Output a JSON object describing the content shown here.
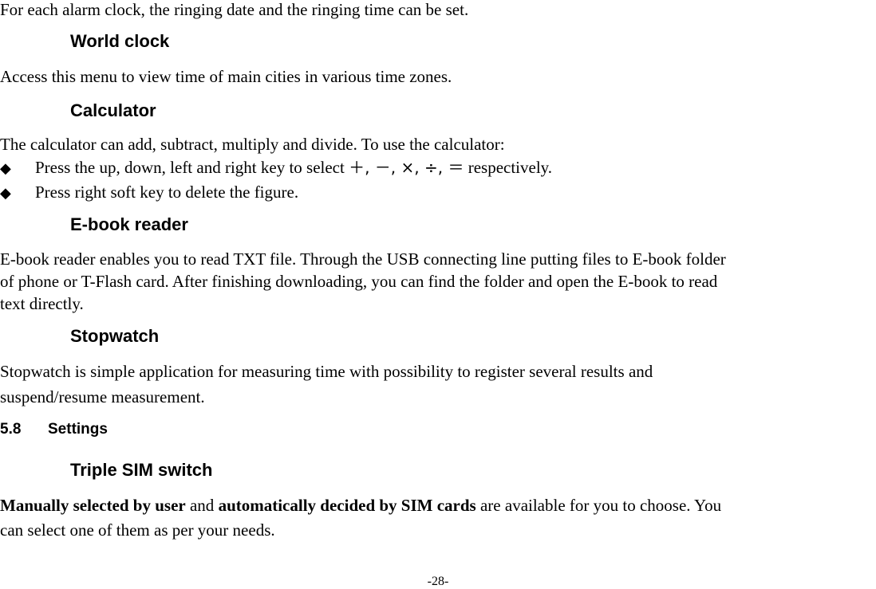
{
  "page": {
    "intro_line": "For each alarm clock, the ringing date and the ringing time can be set.",
    "sections": {
      "world_clock": {
        "heading": "World clock",
        "body": "Access this menu to view time of main cities in various time zones."
      },
      "calculator": {
        "heading": "Calculator",
        "body": "The calculator can add, subtract, multiply and divide. To use the calculator:",
        "bullets": [
          {
            "prefix": "Press the up, down, left and right key to select ",
            "symbols": "＋,  －, ×, ÷,  ＝",
            "suffix": " respectively."
          },
          {
            "text": "Press right soft key to delete the figure."
          }
        ],
        "bullet_icon": "◆"
      },
      "ebook_reader": {
        "heading": "E-book reader",
        "lines": [
          "E-book reader enables you to read TXT file. Through the USB connecting line putting files to E-book folder",
          "of phone or T-Flash card. After finishing downloading, you can find the folder and open the E-book to read",
          "text directly."
        ]
      },
      "stopwatch": {
        "heading": "Stopwatch",
        "lines": [
          "Stopwatch is simple application for measuring time with possibility to register several results and",
          "suspend/resume measurement."
        ]
      }
    },
    "chapter": {
      "number": "5.8",
      "title": "Settings"
    },
    "triple_sim": {
      "heading": "Triple SIM switch",
      "bold_1": "Manually selected by user",
      "mid_1": " and ",
      "bold_2": "automatically decided by SIM cards",
      "tail_1": " are available for you to choose. You",
      "line_2": "can select one of them as per your needs."
    },
    "page_number": "-28-"
  }
}
